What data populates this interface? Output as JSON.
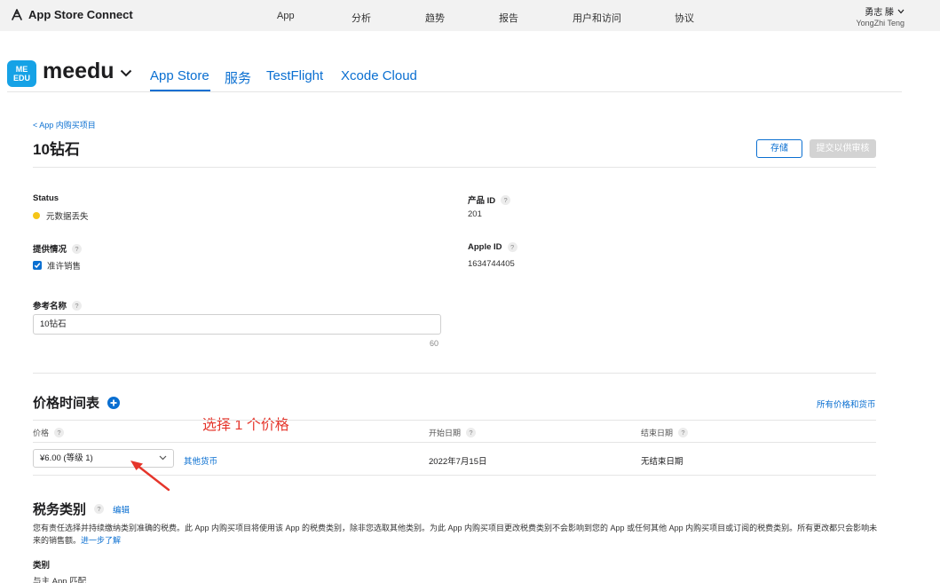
{
  "topbar": {
    "brand": "App Store Connect",
    "nav": [
      "App",
      "分析",
      "趋势",
      "报告",
      "用户和访问",
      "协议"
    ],
    "user_name": "勇志 滕",
    "user_sub": "YongZhi Teng"
  },
  "app": {
    "icon_text_1": "ME",
    "icon_text_2": "EDU",
    "name": "meedu",
    "tabs": [
      "App Store",
      "服务",
      "TestFlight",
      "Xcode Cloud"
    ]
  },
  "page": {
    "back_link": "<  App 内购买项目",
    "title": "10钻石",
    "save_button": "存储",
    "submit_button": "提交以供审核"
  },
  "details": {
    "status_label": "Status",
    "status_value": "元数据丢失",
    "status_color": "#f5c518",
    "product_id_label": "产品 ID",
    "product_id_value": "201",
    "availability_label": "提供情况",
    "availability_value": "准许销售",
    "apple_id_label": "Apple ID",
    "apple_id_value": "1634744405",
    "ref_name_label": "参考名称",
    "ref_name_value": "10钻石",
    "ref_name_count": "60"
  },
  "pricing": {
    "title": "价格时间表",
    "all_prices_link": "所有价格和货币",
    "annotation": "选择 1 个价格",
    "col_price": "价格",
    "col_start": "开始日期",
    "col_end": "结束日期",
    "price_selected": "¥6.00 (等级 1)",
    "other_currency": "其他货币",
    "start_date": "2022年7月15日",
    "end_date": "无结束日期"
  },
  "tax": {
    "title": "税务类别",
    "edit_link": "编辑",
    "description": "您有责任选择并持续缴纳类别准确的税费。此 App 内购买项目将使用该 App 的税费类别，除非您选取其他类别。为此 App 内购买项目更改税费类别不会影响到您的 App 或任何其他 App 内购买项目或订阅的税费类别。所有更改都只会影响未来的销售额。",
    "learn_more": "进一步了解",
    "category_label": "类别",
    "category_value": "与主 App 匹配"
  },
  "colors": {
    "accent": "#0a6fd1",
    "annotation": "#e5352b"
  }
}
